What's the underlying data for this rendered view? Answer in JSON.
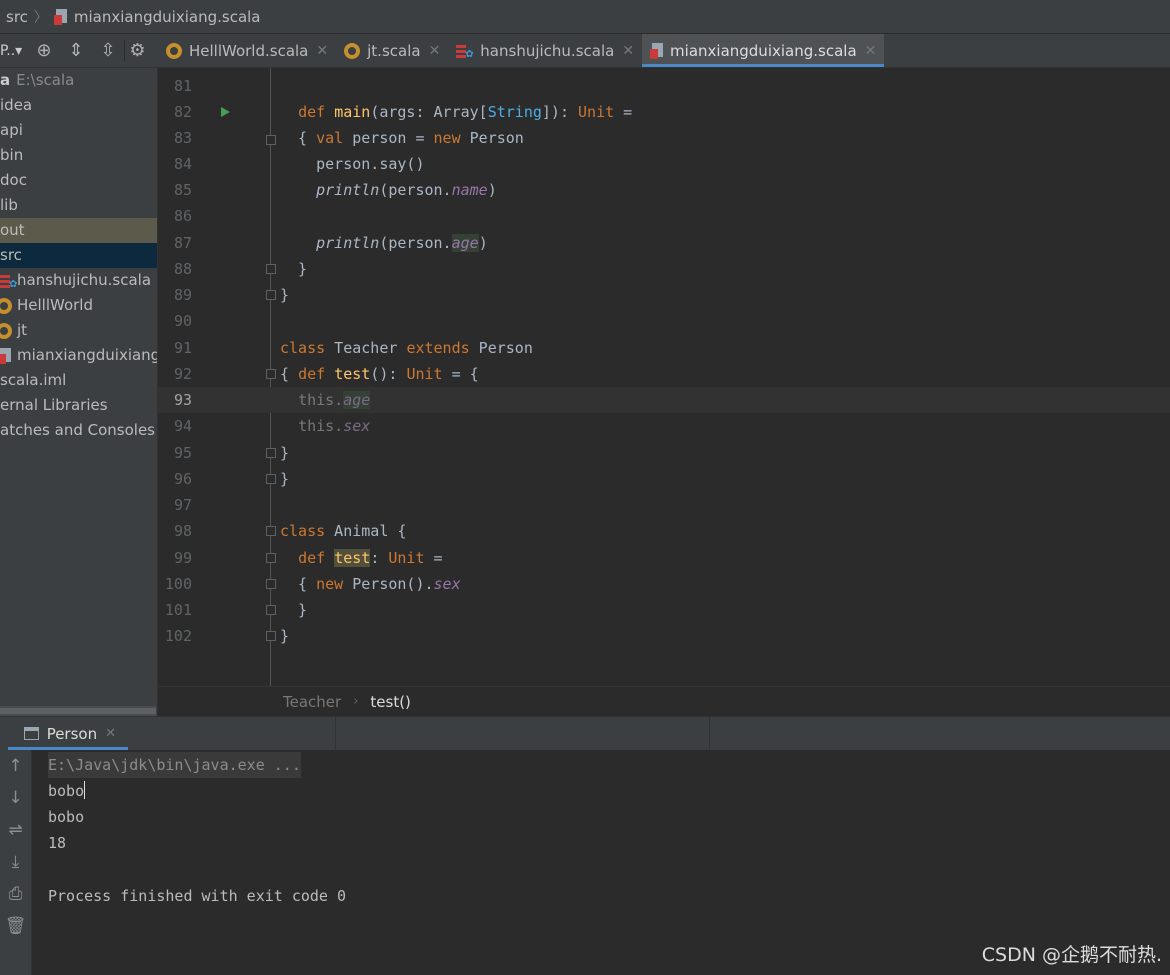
{
  "breadcrumb": {
    "root": "src",
    "file": "mianxiangduixiang.scala"
  },
  "toolbar": {
    "project_label": "P..▾"
  },
  "tabs": [
    {
      "label": "HelllWorld.scala",
      "icon": "scala-object-icon"
    },
    {
      "label": "jt.scala",
      "icon": "scala-object-icon"
    },
    {
      "label": "hanshujichu.scala",
      "icon": "scala-worksheet-icon"
    },
    {
      "label": "mianxiangduixiang.scala",
      "icon": "scala-file-icon",
      "active": true
    }
  ],
  "project_tree": {
    "root_label": "a",
    "root_path": "E:\\scala",
    "items": [
      "idea",
      "api",
      "bin",
      "doc",
      "lib",
      "out",
      "src"
    ],
    "src_children": [
      "hanshujichu.scala",
      "HelllWorld",
      "jt",
      "mianxiangduixiang"
    ],
    "after": [
      "scala.iml",
      "ernal Libraries",
      "atches and Consoles"
    ]
  },
  "editor": {
    "line_numbers": [
      "81",
      "82",
      "83",
      "84",
      "85",
      "86",
      "87",
      "88",
      "89",
      "90",
      "91",
      "92",
      "93",
      "94",
      "95",
      "96",
      "97",
      "98",
      "99",
      "100",
      "101",
      "102"
    ],
    "current_line": "93",
    "breadcrumb": {
      "class": "Teacher",
      "method": "test()"
    }
  },
  "run": {
    "tab_label": "Person",
    "console": {
      "command": "E:\\Java\\jdk\\bin\\java.exe ...",
      "output": [
        "bobo",
        "bobo",
        "18"
      ],
      "exit": "Process finished with exit code 0"
    }
  },
  "watermark": "CSDN @企鹅不耐热.",
  "colors": {
    "background": "#2b2b2b",
    "panel": "#3c3f41",
    "keyword": "#cc7832",
    "function": "#ffc66d",
    "field": "#9876aa",
    "accent": "#4a88c7"
  }
}
